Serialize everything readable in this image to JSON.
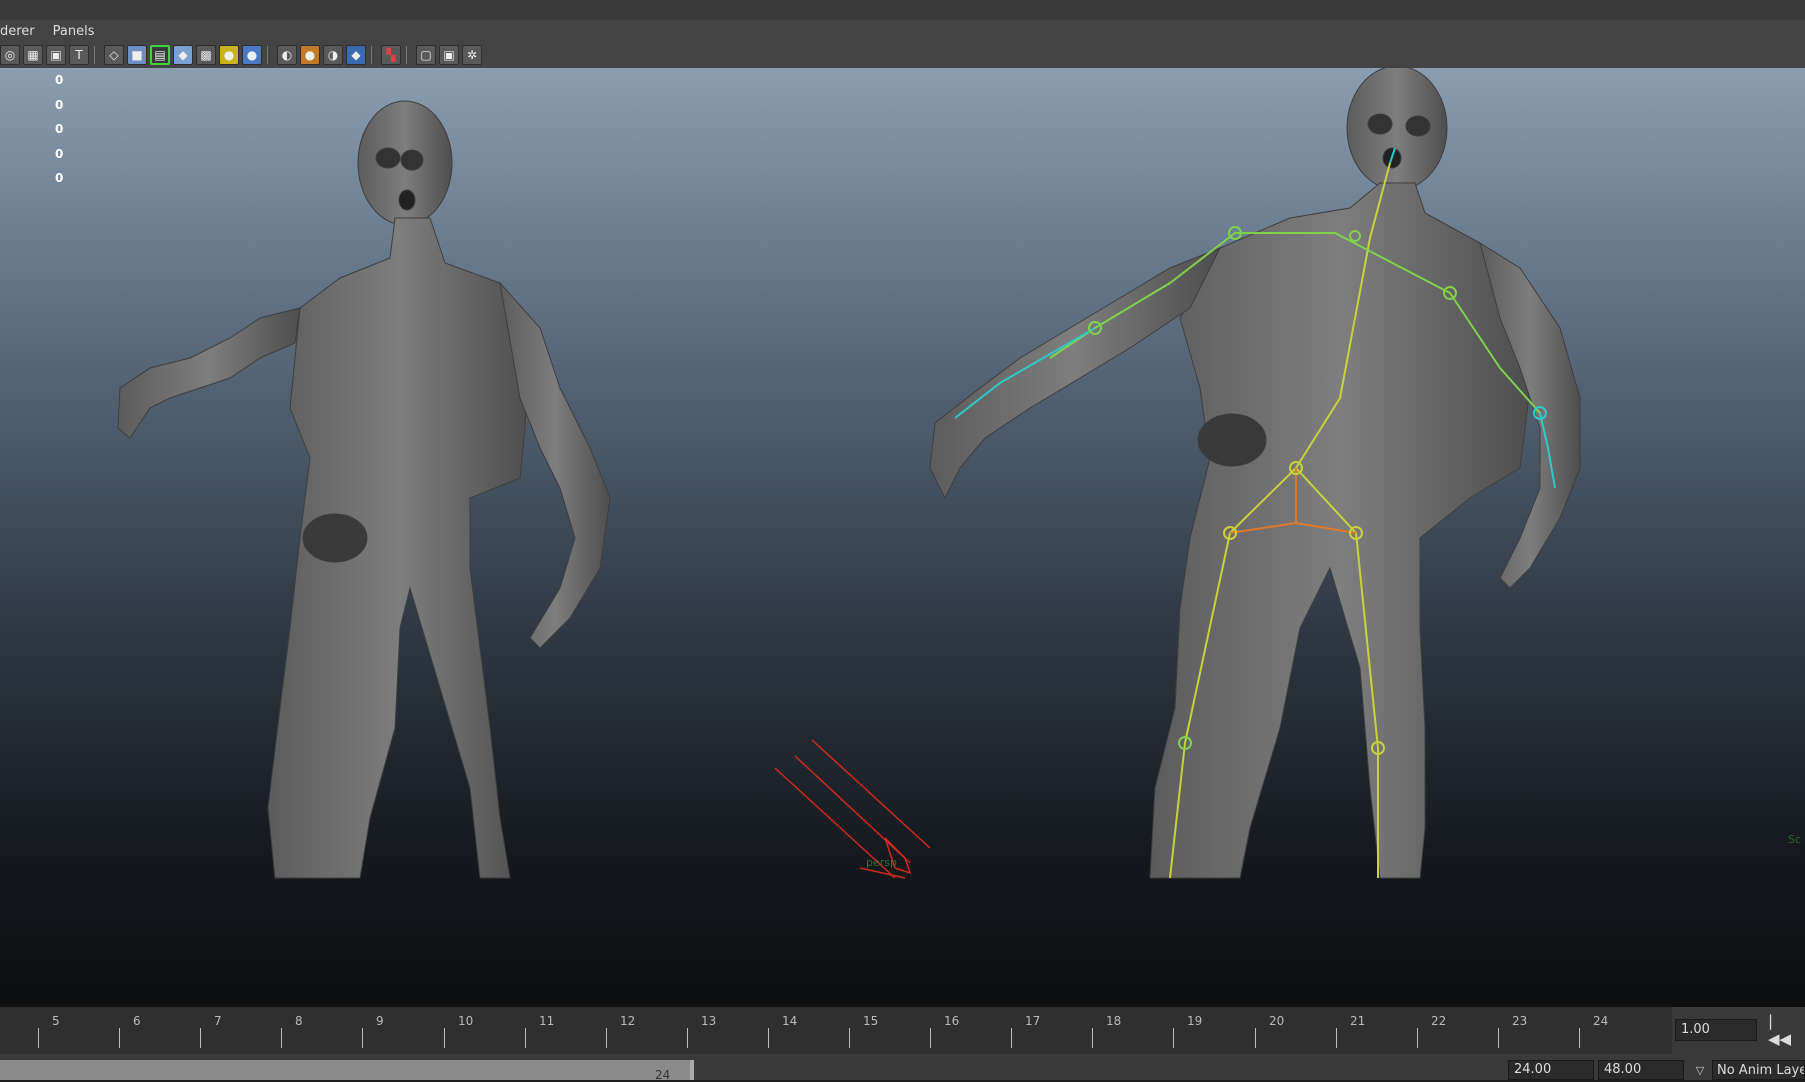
{
  "menu": {
    "items": [
      "derer",
      "Panels"
    ]
  },
  "toolbar": {
    "icons": [
      "camera-icon",
      "grid-toggle-icon",
      "resolution-gate-icon",
      "text-hud-icon",
      "wireframe-icon",
      "smooth-shade-icon",
      "wireframe-on-shaded-icon",
      "default-material-icon",
      "xray-icon",
      "textured-icon",
      "use-all-lights-icon",
      "shadows-icon",
      "screen-space-ao-icon",
      "motion-blur-icon",
      "anti-alias-icon",
      "depth-of-field-icon",
      "isolate-select-icon",
      "xray-joints-icon",
      "xray-active-icon",
      "joints-toggle-icon"
    ]
  },
  "hud": {
    "values": [
      "0",
      "0",
      "0",
      "0",
      "0"
    ]
  },
  "viewport": {
    "camera_label": "persp",
    "corner_label": "Sc",
    "colors": {
      "joint_yellow": "#c8d23a",
      "joint_green": "#7fd24a",
      "joint_cyan": "#2ec9c9",
      "joint_orange": "#e07a2a",
      "camera_red": "#d22a1a"
    }
  },
  "timeline": {
    "ticks": [
      "5",
      "6",
      "7",
      "8",
      "9",
      "10",
      "11",
      "12",
      "13",
      "14",
      "15",
      "16",
      "17",
      "18",
      "19",
      "20",
      "21",
      "22",
      "23",
      "24"
    ],
    "current_frame": "1.00",
    "goto_start_label": "|◀◀"
  },
  "range": {
    "slider_end_label": "24",
    "end_time": "24.00",
    "max_time": "48.00",
    "anim_layer": "No Anim Layer"
  }
}
